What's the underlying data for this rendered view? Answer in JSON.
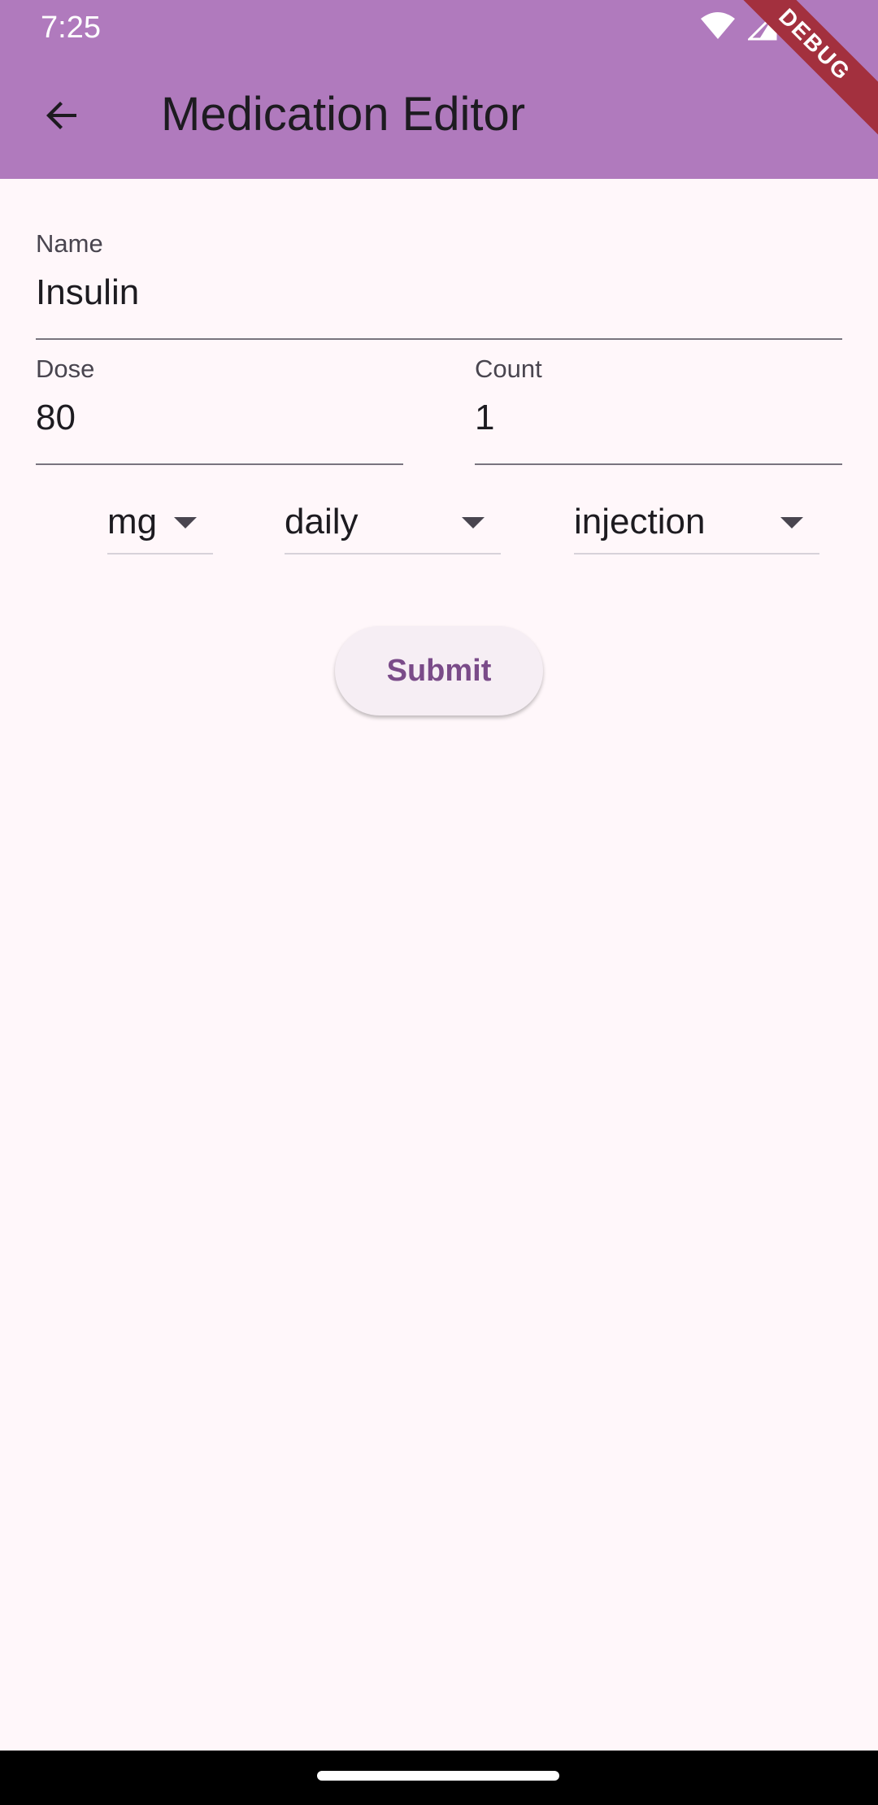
{
  "status_bar": {
    "time": "7:25"
  },
  "app_bar": {
    "title": "Medication Editor",
    "debug_banner": "DEBUG",
    "color": "#B07ABD"
  },
  "form": {
    "name": {
      "label": "Name",
      "value": "Insulin"
    },
    "dose": {
      "label": "Dose",
      "value": "80"
    },
    "count": {
      "label": "Count",
      "value": "1"
    },
    "unit_dropdown": {
      "selected": "mg"
    },
    "frequency_dropdown": {
      "selected": "daily"
    },
    "route_dropdown": {
      "selected": "injection"
    },
    "submit_label": "Submit"
  },
  "colors": {
    "background": "#FFF7FA",
    "accent": "#7A4B89",
    "debug_ribbon": "#A3303E"
  },
  "icons": {
    "back": "arrow-back-icon",
    "wifi": "wifi-icon",
    "signal": "signal-icon",
    "battery": "battery-icon",
    "dropdown": "arrow-drop-down-icon"
  }
}
